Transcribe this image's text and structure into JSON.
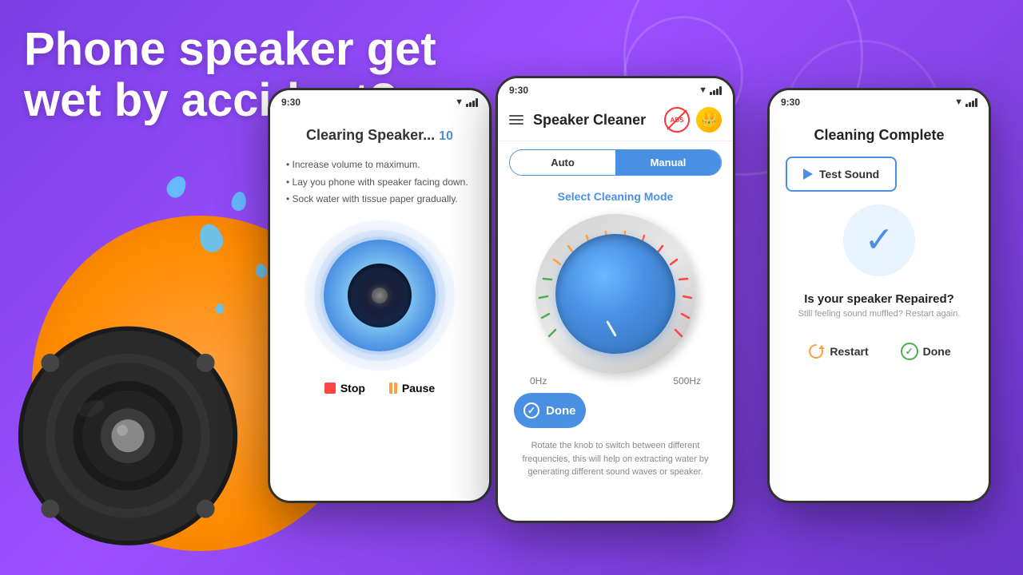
{
  "background": {
    "gradient_start": "#7B3FE4",
    "gradient_end": "#6A35C8"
  },
  "headline": {
    "line1": "Phone speaker get",
    "line2": "wet by accident?"
  },
  "phone1": {
    "status_time": "9:30",
    "title": "Clearing Speaker...",
    "percent": "10",
    "instructions": [
      "Increase volume to maximum.",
      "Lay you phone with speaker facing down.",
      "Sock water with tissue paper gradually."
    ],
    "stop_label": "Stop",
    "pause_label": "Pause"
  },
  "phone2": {
    "status_time": "9:30",
    "app_title": "Speaker Cleaner",
    "tab_auto": "Auto",
    "tab_manual": "Manual",
    "tab_active": "Manual",
    "select_mode_label": "Select Cleaning Mode",
    "freq_min": "0Hz",
    "freq_max": "500Hz",
    "done_label": "Done",
    "instruction": "Rotate the knob to switch between different frequencies, this will help on extracting water by generating different sound waves or speaker."
  },
  "phone3": {
    "status_time": "9:30",
    "complete_title": "Cleaning Complete",
    "test_sound_label": "Test Sound",
    "repaired_question": "Is your speaker Repaired?",
    "repaired_subtitle": "Still feeling sound muffled? Restart again.",
    "restart_label": "Restart",
    "done_label": "Done"
  }
}
